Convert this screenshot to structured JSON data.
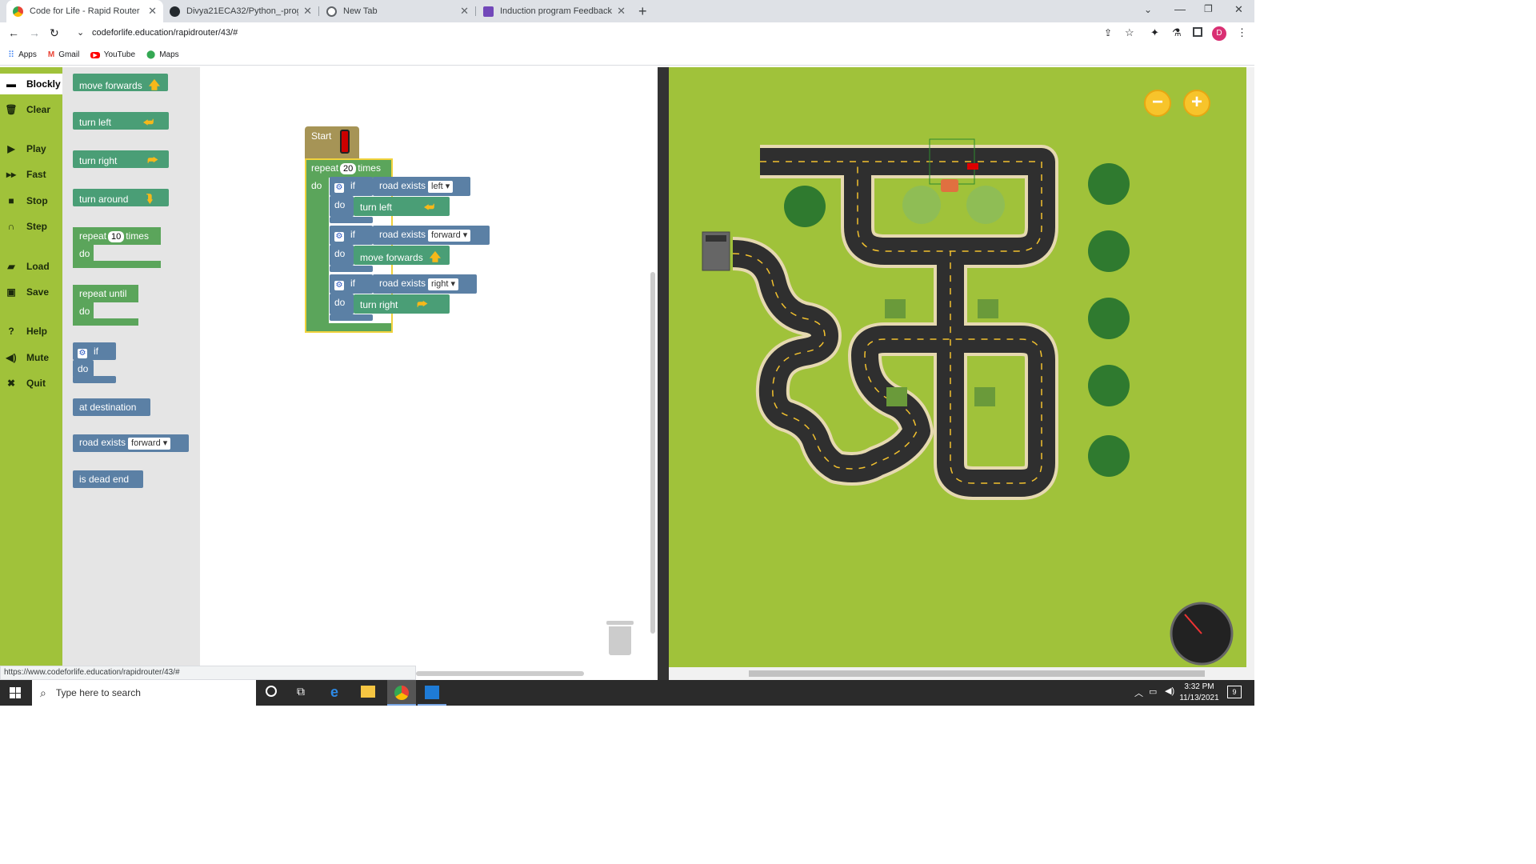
{
  "browser": {
    "tabs": [
      {
        "title": "Code for Life - Rapid Router",
        "active": true
      },
      {
        "title": "Divya21ECA32/Python_-program",
        "active": false
      },
      {
        "title": "New Tab",
        "active": false
      },
      {
        "title": "Induction program Feedback",
        "active": false
      }
    ],
    "url": "codeforlife.education/rapidrouter/43/#",
    "bookmarks": [
      "Apps",
      "Gmail",
      "YouTube",
      "Maps"
    ],
    "status_url": "https://www.codeforlife.education/rapidrouter/43/#"
  },
  "menu": {
    "items": [
      "Blockly",
      "Clear",
      "Play",
      "Fast",
      "Stop",
      "Step",
      "Load",
      "Save",
      "Help",
      "Mute",
      "Quit"
    ]
  },
  "toolbox": {
    "move_forwards": "move forwards",
    "turn_left": "turn left",
    "turn_right": "turn right",
    "turn_around": "turn around",
    "repeat": "repeat",
    "repeat_count": "10",
    "times": "times",
    "do": "do",
    "repeat_until": "repeat until",
    "if": "if",
    "at_destination": "at destination",
    "road_exists": "road exists",
    "road_exists_option": "forward",
    "is_dead_end": "is dead end"
  },
  "program": {
    "start": "Start",
    "repeat": "repeat",
    "repeat_count": "20",
    "times": "times",
    "do": "do",
    "if": "if",
    "road_exists": "road exists",
    "cond1": "left",
    "action1": "turn left",
    "cond2": "forward",
    "action2": "move forwards",
    "cond3": "right",
    "action3": "turn right"
  },
  "map": {
    "zoom_out": "−",
    "zoom_in": "+"
  },
  "taskbar": {
    "search_placeholder": "Type here to search",
    "time": "3:32 PM",
    "date": "11/13/2021",
    "notifications": "9"
  },
  "colors": {
    "grass": "#a0c23a",
    "road": "#2f2f2f",
    "action_block": "#4a9e76",
    "condition_block": "#5b80a5",
    "control_block": "#5ba55b"
  }
}
